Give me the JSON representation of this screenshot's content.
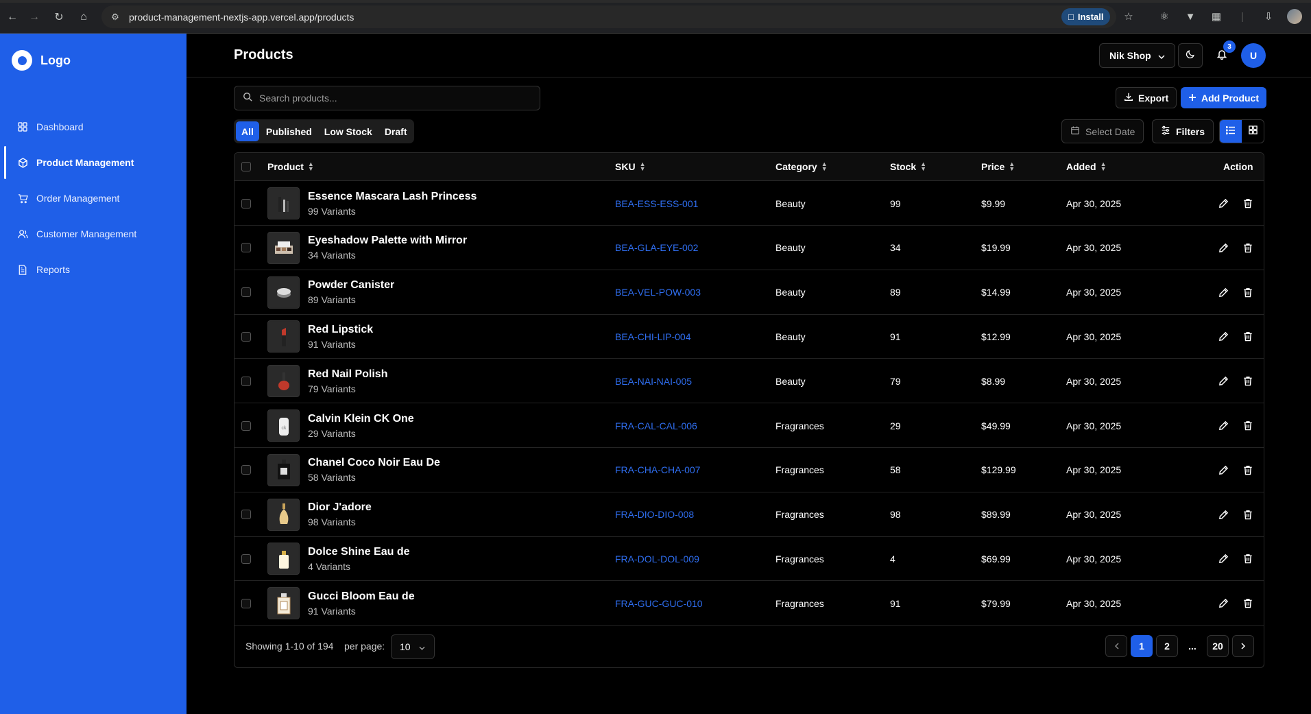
{
  "browser": {
    "url": "product-management-nextjs-app.vercel.app/products",
    "install_label": "Install"
  },
  "sidebar": {
    "logo_text": "Logo",
    "items": [
      {
        "label": "Dashboard",
        "icon": "grid-icon"
      },
      {
        "label": "Product Management",
        "icon": "box-icon"
      },
      {
        "label": "Order Management",
        "icon": "cart-icon"
      },
      {
        "label": "Customer Management",
        "icon": "users-icon"
      },
      {
        "label": "Reports",
        "icon": "document-icon"
      }
    ],
    "active_index": 1
  },
  "header": {
    "title": "Products",
    "shop_name": "Nik Shop",
    "notification_count": "3",
    "avatar_initial": "U"
  },
  "toolbar": {
    "search_placeholder": "Search products...",
    "export_label": "Export",
    "add_label": "Add Product",
    "date_placeholder": "Select Date",
    "filters_label": "Filters",
    "view_mode": "list"
  },
  "tabs": [
    {
      "label": "All",
      "active": true
    },
    {
      "label": "Published",
      "active": false
    },
    {
      "label": "Low Stock",
      "active": false
    },
    {
      "label": "Draft",
      "active": false
    }
  ],
  "table": {
    "columns": {
      "product": "Product",
      "sku": "SKU",
      "category": "Category",
      "stock": "Stock",
      "price": "Price",
      "added": "Added",
      "action": "Action"
    },
    "rows": [
      {
        "name": "Essence Mascara Lash Princess",
        "variants": "99 Variants",
        "sku": "BEA-ESS-ESS-001",
        "category": "Beauty",
        "stock": "99",
        "price": "$9.99",
        "added": "Apr 30, 2025",
        "thumb": "mascara"
      },
      {
        "name": "Eyeshadow Palette with Mirror",
        "variants": "34 Variants",
        "sku": "BEA-GLA-EYE-002",
        "category": "Beauty",
        "stock": "34",
        "price": "$19.99",
        "added": "Apr 30, 2025",
        "thumb": "palette"
      },
      {
        "name": "Powder Canister",
        "variants": "89 Variants",
        "sku": "BEA-VEL-POW-003",
        "category": "Beauty",
        "stock": "89",
        "price": "$14.99",
        "added": "Apr 30, 2025",
        "thumb": "powder"
      },
      {
        "name": "Red Lipstick",
        "variants": "91 Variants",
        "sku": "BEA-CHI-LIP-004",
        "category": "Beauty",
        "stock": "91",
        "price": "$12.99",
        "added": "Apr 30, 2025",
        "thumb": "lipstick"
      },
      {
        "name": "Red Nail Polish",
        "variants": "79 Variants",
        "sku": "BEA-NAI-NAI-005",
        "category": "Beauty",
        "stock": "79",
        "price": "$8.99",
        "added": "Apr 30, 2025",
        "thumb": "nailpolish"
      },
      {
        "name": "Calvin Klein CK One",
        "variants": "29 Variants",
        "sku": "FRA-CAL-CAL-006",
        "category": "Fragrances",
        "stock": "29",
        "price": "$49.99",
        "added": "Apr 30, 2025",
        "thumb": "ckone"
      },
      {
        "name": "Chanel Coco Noir Eau De",
        "variants": "58 Variants",
        "sku": "FRA-CHA-CHA-007",
        "category": "Fragrances",
        "stock": "58",
        "price": "$129.99",
        "added": "Apr 30, 2025",
        "thumb": "chanel"
      },
      {
        "name": "Dior J'adore",
        "variants": "98 Variants",
        "sku": "FRA-DIO-DIO-008",
        "category": "Fragrances",
        "stock": "98",
        "price": "$89.99",
        "added": "Apr 30, 2025",
        "thumb": "dior"
      },
      {
        "name": "Dolce Shine Eau de",
        "variants": "4 Variants",
        "sku": "FRA-DOL-DOL-009",
        "category": "Fragrances",
        "stock": "4",
        "price": "$69.99",
        "added": "Apr 30, 2025",
        "thumb": "dolce"
      },
      {
        "name": "Gucci Bloom Eau de",
        "variants": "91 Variants",
        "sku": "FRA-GUC-GUC-010",
        "category": "Fragrances",
        "stock": "91",
        "price": "$79.99",
        "added": "Apr 30, 2025",
        "thumb": "gucci"
      }
    ]
  },
  "footer": {
    "showing": "Showing 1-10 of 194",
    "per_page_label": "per page:",
    "per_page_value": "10",
    "pages": [
      "1",
      "2",
      "...",
      "20"
    ],
    "current_page": "1"
  },
  "colors": {
    "accent": "#1f5fe8",
    "sku_link": "#2f6ef0",
    "background": "#000000"
  }
}
